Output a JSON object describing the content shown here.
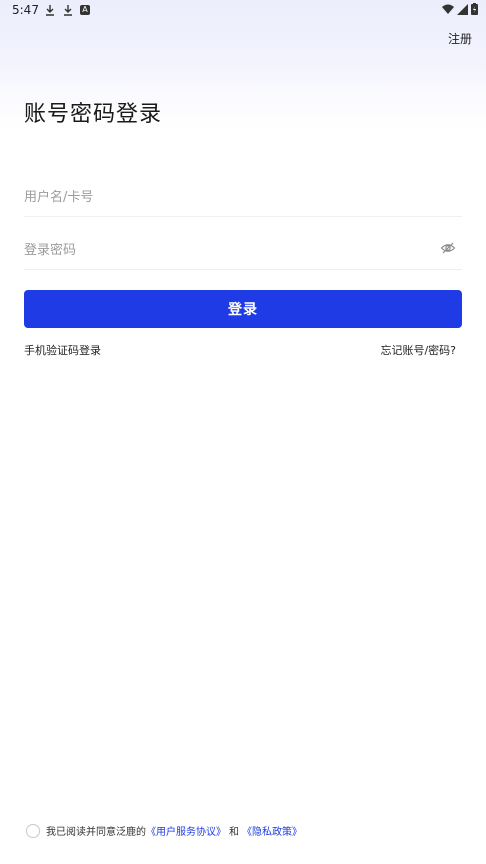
{
  "status_bar": {
    "time": "5:47",
    "left_icons": [
      "download-icon",
      "download-icon",
      "a-icon"
    ],
    "right_icons": [
      "wifi-icon",
      "signal-icon",
      "battery-icon"
    ]
  },
  "header": {
    "register_label": "注册"
  },
  "main": {
    "title": "账号密码登录",
    "username_placeholder": "用户名/卡号",
    "password_placeholder": "登录密码",
    "login_label": "登录",
    "sms_login_label": "手机验证码登录",
    "forgot_label": "忘记账号/密码?"
  },
  "agreement": {
    "prefix": "我已阅读并同意泛鹿的",
    "user_agreement": "《用户服务协议》",
    "and": "和",
    "privacy_policy": "《隐私政策》"
  },
  "colors": {
    "accent": "#1f3be6"
  }
}
